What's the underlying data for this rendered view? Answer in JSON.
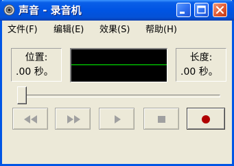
{
  "window": {
    "title": "声音 - 录音机",
    "icons": {
      "app": "speaker-icon",
      "minimize": "minimize-icon",
      "maximize": "maximize-icon",
      "close": "close-icon"
    },
    "colors": {
      "titlebar": "#0054e3",
      "close": "#e05a34",
      "waveform_bg": "#000000",
      "waveform_line": "#00ff00",
      "record": "#b00000"
    }
  },
  "menu": {
    "file": "文件(F)",
    "edit": "编辑(E)",
    "effects": "效果(S)",
    "help": "帮助(H)"
  },
  "position": {
    "label": "位置:",
    "value": ".00 秒。"
  },
  "length": {
    "label": "长度:",
    "value": ".00 秒。"
  },
  "seek_slider": {
    "value_fraction": 0
  },
  "controls": {
    "seek_start_icon": "rewind-icon",
    "seek_end_icon": "fast-forward-icon",
    "play_icon": "play-icon",
    "stop_icon": "stop-icon",
    "record_icon": "record-icon"
  }
}
